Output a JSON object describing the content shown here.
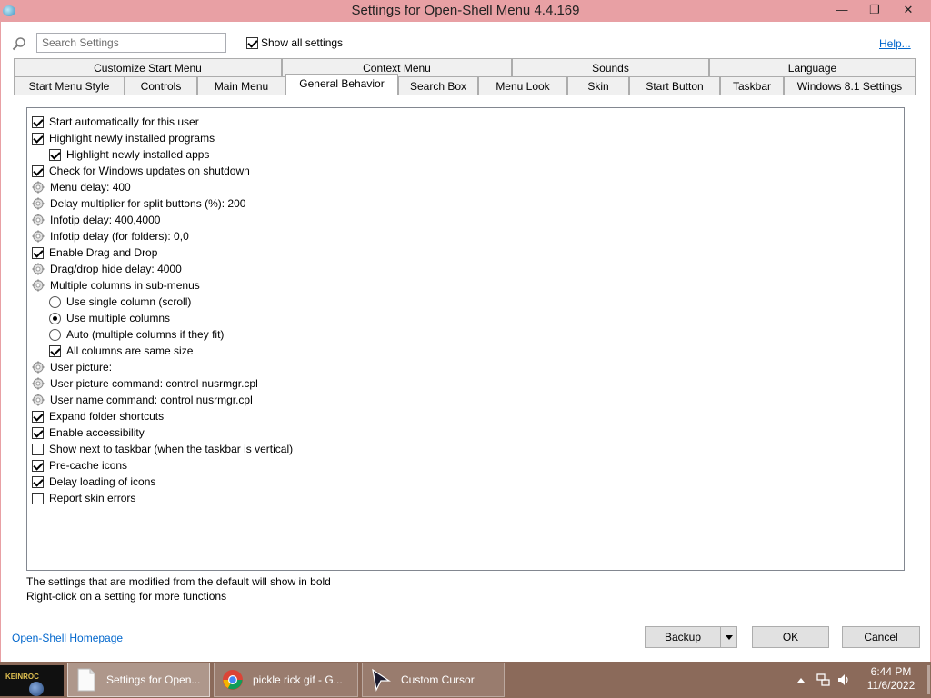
{
  "window": {
    "title": "Settings for Open-Shell Menu 4.4.169",
    "controls": {
      "minimize": "—",
      "restore": "❐",
      "close": "✕"
    }
  },
  "toolbar": {
    "search_placeholder": "Search Settings",
    "show_all_label": "Show all settings",
    "show_all_checked": true,
    "help_label": "Help..."
  },
  "tabs": {
    "row1": [
      "Customize Start Menu",
      "Context Menu",
      "Sounds",
      "Language"
    ],
    "row2": [
      "Start Menu Style",
      "Controls",
      "Main Menu",
      "General Behavior",
      "Search Box",
      "Menu Look",
      "Skin",
      "Start Button",
      "Taskbar",
      "Windows 8.1 Settings"
    ],
    "active": "General Behavior"
  },
  "settings": [
    {
      "type": "checkbox",
      "checked": true,
      "indent": 0,
      "label": "Start automatically for this user"
    },
    {
      "type": "checkbox",
      "checked": true,
      "indent": 0,
      "label": "Highlight newly installed programs"
    },
    {
      "type": "checkbox",
      "checked": true,
      "indent": 1,
      "label": "Highlight newly installed apps"
    },
    {
      "type": "checkbox",
      "checked": true,
      "indent": 0,
      "label": "Check for Windows updates on shutdown"
    },
    {
      "type": "gear",
      "indent": 0,
      "label": "Menu delay: 400"
    },
    {
      "type": "gear",
      "indent": 0,
      "label": "Delay multiplier for split buttons (%): 200"
    },
    {
      "type": "gear",
      "indent": 0,
      "label": "Infotip delay: 400,4000"
    },
    {
      "type": "gear",
      "indent": 0,
      "label": "Infotip delay (for folders): 0,0"
    },
    {
      "type": "checkbox",
      "checked": true,
      "indent": 0,
      "label": "Enable Drag and Drop"
    },
    {
      "type": "gear",
      "indent": 0,
      "label": "Drag/drop hide delay: 4000"
    },
    {
      "type": "gear",
      "indent": 0,
      "label": "Multiple columns in sub-menus"
    },
    {
      "type": "radio",
      "checked": false,
      "indent": 1,
      "label": "Use single column (scroll)"
    },
    {
      "type": "radio",
      "checked": true,
      "indent": 1,
      "label": "Use multiple columns"
    },
    {
      "type": "radio",
      "checked": false,
      "indent": 1,
      "label": "Auto (multiple columns if they fit)"
    },
    {
      "type": "checkbox",
      "checked": true,
      "indent": 1,
      "label": "All columns are same size"
    },
    {
      "type": "gear",
      "indent": 0,
      "label": "User picture:"
    },
    {
      "type": "gear",
      "indent": 0,
      "label": "User picture command: control nusrmgr.cpl"
    },
    {
      "type": "gear",
      "indent": 0,
      "label": "User name command: control nusrmgr.cpl"
    },
    {
      "type": "checkbox",
      "checked": true,
      "indent": 0,
      "label": "Expand folder shortcuts"
    },
    {
      "type": "checkbox",
      "checked": true,
      "indent": 0,
      "label": "Enable accessibility"
    },
    {
      "type": "checkbox",
      "checked": false,
      "indent": 0,
      "label": "Show next to taskbar (when the taskbar is vertical)"
    },
    {
      "type": "checkbox",
      "checked": true,
      "indent": 0,
      "label": "Pre-cache icons"
    },
    {
      "type": "checkbox",
      "checked": true,
      "indent": 0,
      "label": "Delay loading of icons"
    },
    {
      "type": "checkbox",
      "checked": false,
      "indent": 0,
      "label": "Report skin errors"
    }
  ],
  "info": {
    "line1": "The settings that are modified from the default will show in bold",
    "line2": "Right-click on a setting for more functions"
  },
  "footer": {
    "homepage_link": "Open-Shell Homepage",
    "backup_label": "Backup",
    "ok_label": "OK",
    "cancel_label": "Cancel"
  },
  "taskbar": {
    "start_logo_text": "KEINROC",
    "items": [
      {
        "label": "Settings for Open...",
        "icon": "document-icon",
        "active": true
      },
      {
        "label": "pickle rick gif - G...",
        "icon": "chrome-icon",
        "active": false
      },
      {
        "label": "Custom Cursor",
        "icon": "cursor-icon",
        "active": false
      }
    ],
    "clock_time": "6:44 PM",
    "clock_date": "11/6/2022"
  },
  "colors": {
    "titlebar": "#e8a0a4",
    "taskbar": "#8b6a5a",
    "link": "#0066cc"
  }
}
